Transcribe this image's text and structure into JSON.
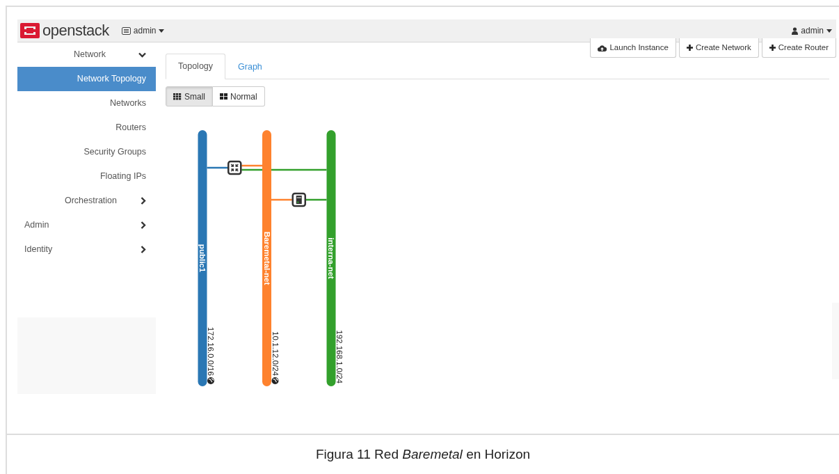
{
  "header": {
    "logo": "openstack",
    "project": "admin",
    "user": "admin"
  },
  "sidebar": {
    "panels": [
      {
        "label": "Network",
        "expanded": true,
        "children": [
          {
            "label": "Network Topology",
            "selected": true
          },
          {
            "label": "Networks",
            "selected": false
          },
          {
            "label": "Routers",
            "selected": false
          },
          {
            "label": "Security Groups",
            "selected": false
          },
          {
            "label": "Floating IPs",
            "selected": false
          }
        ]
      },
      {
        "label": "Orchestration",
        "expanded": false
      }
    ],
    "dashboards": [
      {
        "label": "Admin",
        "expanded": false
      },
      {
        "label": "Identity",
        "expanded": false
      }
    ]
  },
  "actions": [
    {
      "kind": "launch",
      "label": "Launch Instance"
    },
    {
      "kind": "create",
      "label": "Create Network"
    },
    {
      "kind": "create",
      "label": "Create Router"
    }
  ],
  "tabs": [
    {
      "label": "Topology",
      "selected": true
    },
    {
      "label": "Graph",
      "selected": false
    }
  ],
  "view_toggle": [
    {
      "kind": "small",
      "label": "Small",
      "selected": true
    },
    {
      "kind": "normal",
      "label": "Normal",
      "selected": false
    }
  ],
  "topology": {
    "networks": [
      {
        "name": "public1",
        "cidr": "172.16.0.0/16",
        "color": "#2a77b4",
        "globe": true
      },
      {
        "name": "Baremetal-net",
        "cidr": "10.1.12.0/24",
        "color": "#fe822e",
        "globe": true
      },
      {
        "name": "interna-net",
        "cidr": "192.168.1.0/24",
        "color": "#33a02c",
        "globe": false
      }
    ],
    "devices": [
      {
        "kind": "router",
        "ports": [
          true,
          true,
          true
        ]
      },
      {
        "kind": "instance",
        "ports": [
          false,
          true,
          true
        ]
      }
    ]
  },
  "caption": "Figura 11 Red *Baremetal* en Horizon"
}
